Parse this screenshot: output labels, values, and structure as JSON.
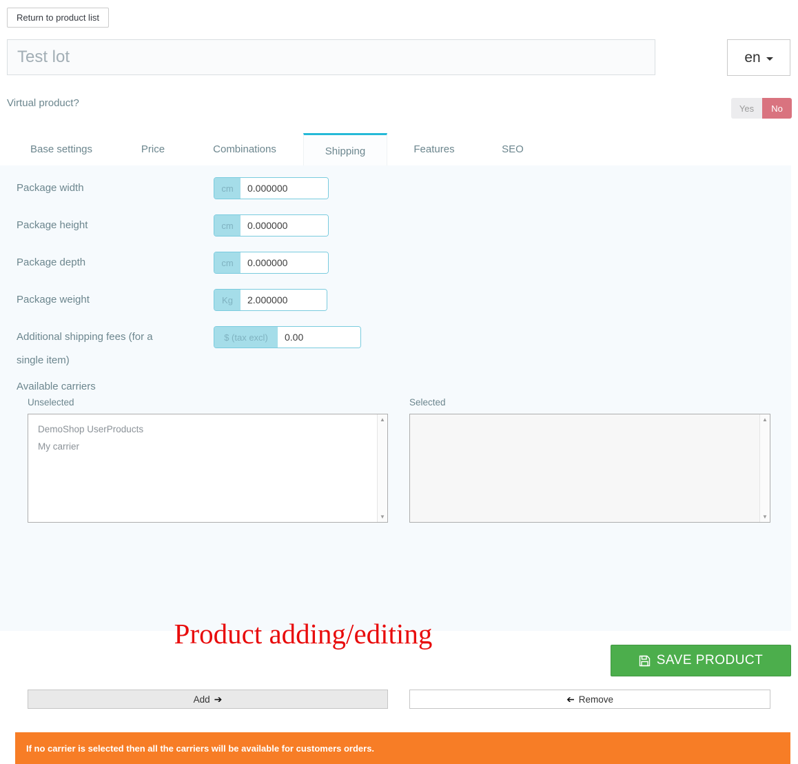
{
  "header": {
    "return_button": "Return to product list",
    "product_name": "Test lot",
    "language": "en",
    "virtual_product_label": "Virtual product?",
    "toggle": {
      "yes": "Yes",
      "no": "No",
      "selected": "No"
    }
  },
  "tabs": [
    {
      "label": "Base settings",
      "active": false
    },
    {
      "label": "Price",
      "active": false
    },
    {
      "label": "Combinations",
      "active": false
    },
    {
      "label": "Shipping",
      "active": true
    },
    {
      "label": "Features",
      "active": false
    },
    {
      "label": "SEO",
      "active": false
    }
  ],
  "shipping": {
    "fields": [
      {
        "label": "Package width",
        "unit": "cm",
        "value": "0.000000"
      },
      {
        "label": "Package height",
        "unit": "cm",
        "value": "0.000000"
      },
      {
        "label": "Package depth",
        "unit": "cm",
        "value": "0.000000"
      },
      {
        "label": "Package weight",
        "unit": "Kg",
        "value": "2.000000"
      },
      {
        "label": "Additional shipping fees (for a single item)",
        "unit": "$ (tax excl)",
        "value": "0.00"
      }
    ],
    "carriers": {
      "section_label": "Available carriers",
      "unselected_label": "Unselected",
      "selected_label": "Selected",
      "unselected_items": [
        "DemoShop UserProducts",
        "My carrier"
      ],
      "selected_items": [],
      "add_label": "Add",
      "remove_label": "Remove"
    },
    "warning": "If no carrier is selected then all the carriers will be available for customers orders."
  },
  "footer": {
    "watermark": "Product adding/editing",
    "save_button": "SAVE PRODUCT"
  },
  "icons": {
    "language_caret": "caret-down",
    "add_arrow": "arrow-right",
    "remove_arrow": "arrow-left",
    "save": "floppy-disk",
    "scroll_up": "triangle-up",
    "scroll_down": "triangle-down"
  },
  "colors": {
    "accent_teal": "#25b9d7",
    "panel_background": "#f6fafd",
    "input_border": "#79cbde",
    "unit_badge": "#a5dde9",
    "toggle_no": "#d9737f",
    "warning_orange": "#f77d26",
    "watermark_red": "#e80c0c",
    "save_green": "#4cae4c",
    "label_gray_blue": "#6c868e"
  }
}
